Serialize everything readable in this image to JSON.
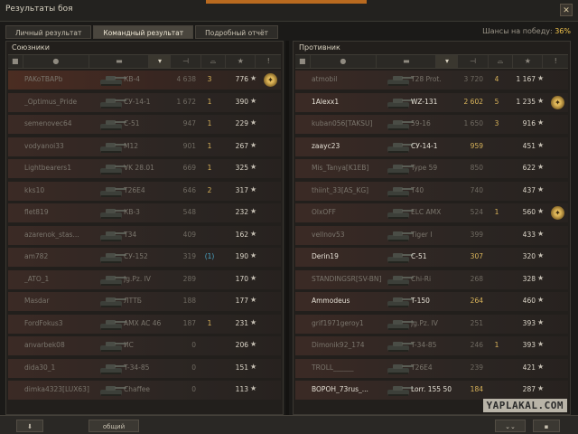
{
  "window": {
    "title": "Результаты боя",
    "close_symbol": "✕"
  },
  "tabs": [
    {
      "label": "Личный результат",
      "active": false
    },
    {
      "label": "Командный результат",
      "active": true
    },
    {
      "label": "Подробный отчёт",
      "active": false
    }
  ],
  "win_chance": {
    "label": "Шансы на победу:",
    "value": "36%"
  },
  "allies": {
    "title": "Союзники",
    "players": [
      {
        "player": "PAKoTBAPb",
        "tank": "КВ-4",
        "damage": "4 638",
        "kills": "3",
        "xp": "776",
        "medal": true,
        "self": true,
        "alive": false
      },
      {
        "player": "_Optimus_Pride",
        "tank": "СУ-14-1",
        "damage": "1 672",
        "kills": "1",
        "xp": "390",
        "medal": false,
        "self": false,
        "alive": false
      },
      {
        "player": "semenovec64",
        "tank": "С-51",
        "damage": "947",
        "kills": "1",
        "xp": "229",
        "medal": false,
        "self": false,
        "alive": false
      },
      {
        "player": "vodyanoi33",
        "tank": "M12",
        "damage": "901",
        "kills": "1",
        "xp": "267",
        "medal": false,
        "self": false,
        "alive": false
      },
      {
        "player": "Lightbearers1",
        "tank": "VK 28.01",
        "damage": "669",
        "kills": "1",
        "xp": "325",
        "medal": false,
        "self": false,
        "alive": false
      },
      {
        "player": "kks10",
        "tank": "T26E4",
        "damage": "646",
        "kills": "2",
        "xp": "317",
        "medal": false,
        "self": false,
        "alive": false
      },
      {
        "player": "flet819",
        "tank": "КВ-3",
        "damage": "548",
        "kills": "",
        "xp": "232",
        "medal": false,
        "self": false,
        "alive": false
      },
      {
        "player": "azarenok_stas...",
        "tank": "Т34",
        "damage": "409",
        "kills": "",
        "xp": "162",
        "medal": false,
        "self": false,
        "alive": false
      },
      {
        "player": "am782",
        "tank": "СУ-152",
        "damage": "319",
        "kills": "(1)",
        "xp": "190",
        "medal": false,
        "self": false,
        "alive": false
      },
      {
        "player": "_ATO_1",
        "tank": "Jg.Pz. IV",
        "damage": "289",
        "kills": "",
        "xp": "170",
        "medal": false,
        "self": false,
        "alive": false
      },
      {
        "player": "Masdar",
        "tank": "ЛТТБ",
        "damage": "188",
        "kills": "",
        "xp": "177",
        "medal": false,
        "self": false,
        "alive": false
      },
      {
        "player": "FordFokus3",
        "tank": "AMX AC 46",
        "damage": "187",
        "kills": "1",
        "xp": "231",
        "medal": false,
        "self": false,
        "alive": false
      },
      {
        "player": "anvarbek08",
        "tank": "ИС",
        "damage": "0",
        "kills": "",
        "xp": "206",
        "medal": false,
        "self": false,
        "alive": false
      },
      {
        "player": "dida30_1",
        "tank": "T-34-85",
        "damage": "0",
        "kills": "",
        "xp": "151",
        "medal": false,
        "self": false,
        "alive": false
      },
      {
        "player": "dimka4323[LUX63]",
        "tank": "Chaffee",
        "damage": "0",
        "kills": "",
        "xp": "113",
        "medal": false,
        "self": false,
        "alive": false
      }
    ]
  },
  "enemies": {
    "title": "Противник",
    "players": [
      {
        "player": "atmobil",
        "tank": "T28 Prot.",
        "damage": "3 720",
        "kills": "4",
        "xp": "1 167",
        "medal": false,
        "alive": false
      },
      {
        "player": "1Alexx1",
        "tank": "WZ-131",
        "damage": "2 602",
        "kills": "5",
        "xp": "1 235",
        "medal": true,
        "alive": true
      },
      {
        "player": "kuban056[TAKSU]",
        "tank": "59-16",
        "damage": "1 650",
        "kills": "3",
        "xp": "916",
        "medal": false,
        "alive": false
      },
      {
        "player": "zaayc23",
        "tank": "СУ-14-1",
        "damage": "959",
        "kills": "",
        "xp": "451",
        "medal": false,
        "alive": true
      },
      {
        "player": "Mis_Tanya[K1EB]",
        "tank": "Type 59",
        "damage": "850",
        "kills": "",
        "xp": "622",
        "medal": false,
        "alive": false
      },
      {
        "player": "thiint_33[AS_KG]",
        "tank": "Т40",
        "damage": "740",
        "kills": "",
        "xp": "437",
        "medal": false,
        "alive": false
      },
      {
        "player": "OlxOFF",
        "tank": "ELC AMX",
        "damage": "524",
        "kills": "1",
        "xp": "560",
        "medal": true,
        "alive": false
      },
      {
        "player": "vellnov53",
        "tank": "Tiger I",
        "damage": "399",
        "kills": "",
        "xp": "433",
        "medal": false,
        "alive": false
      },
      {
        "player": "Derin19",
        "tank": "С-51",
        "damage": "307",
        "kills": "",
        "xp": "320",
        "medal": false,
        "alive": true
      },
      {
        "player": "STANDINGSR[SV-BN]",
        "tank": "Chi-Ri",
        "damage": "268",
        "kills": "",
        "xp": "328",
        "medal": false,
        "alive": false
      },
      {
        "player": "Ammodeus",
        "tank": "T-150",
        "damage": "264",
        "kills": "",
        "xp": "460",
        "medal": false,
        "alive": true
      },
      {
        "player": "grif1971geroy1",
        "tank": "Jg.Pz. IV",
        "damage": "251",
        "kills": "",
        "xp": "393",
        "medal": false,
        "alive": false
      },
      {
        "player": "Dimonik92_174",
        "tank": "T-34-85",
        "damage": "246",
        "kills": "1",
        "xp": "393",
        "medal": false,
        "alive": false
      },
      {
        "player": "TROLL______",
        "tank": "T26E4",
        "damage": "239",
        "kills": "",
        "xp": "421",
        "medal": false,
        "alive": false
      },
      {
        "player": "BOPOH_73rus_...",
        "tank": "Lorr. 155 50",
        "damage": "184",
        "kills": "",
        "xp": "287",
        "medal": false,
        "alive": true
      }
    ]
  },
  "icons": {
    "squad": "square-icon",
    "player": "person-icon",
    "tank": "tank-icon",
    "damage": "sort-damage-icon",
    "kills": "kills-icon",
    "xp": "star-icon",
    "medal": "medal-icon"
  },
  "watermark": "YAPLAKAL.COM",
  "footer": {
    "left_btn": "⬇",
    "mid_btn": "общий"
  },
  "colors": {
    "accent": "#b96a1f",
    "gold": "#f0c24c",
    "kills_blue": "#4aa6c7"
  }
}
